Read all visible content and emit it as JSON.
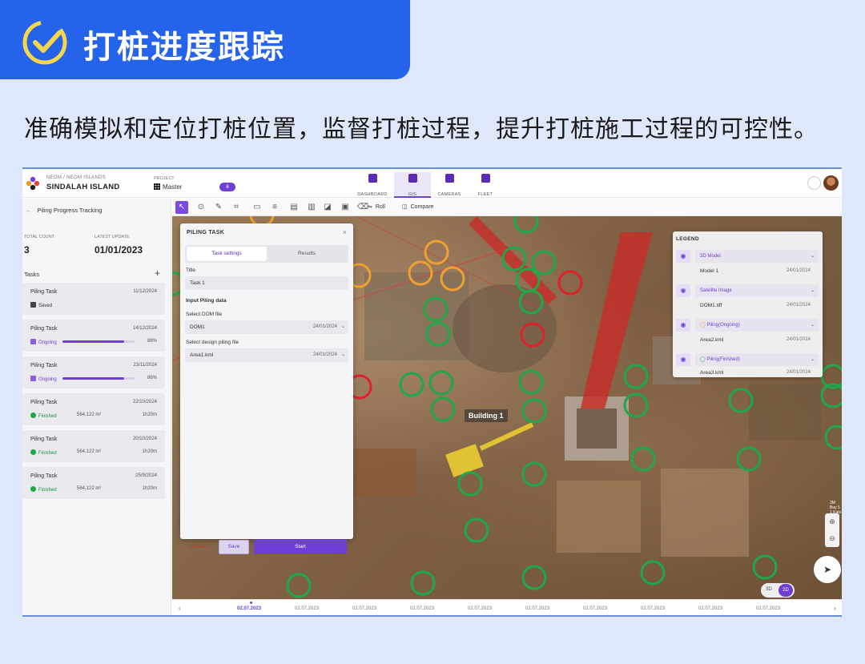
{
  "banner": {
    "title": "打桩进度跟踪",
    "subtitle": "准确模拟和定位打桩位置，监督打桩过程，提升打桩施工过程的可控性。"
  },
  "header": {
    "org": "NEOM / NEOM ISLANDS",
    "island": "SINDALAH ISLAND",
    "project_label": "PROJECT",
    "project_value": "Master",
    "project_badge": "6",
    "tabs": [
      {
        "label": "DASHBOARD",
        "icon": "dashboard-icon"
      },
      {
        "label": "GIS",
        "icon": "map-icon",
        "active": true
      },
      {
        "label": "CAMERAS",
        "icon": "camera-icon"
      },
      {
        "label": "FLEET",
        "icon": "truck-icon"
      }
    ]
  },
  "left": {
    "title": "Piling Progress Tracking",
    "total_count_label": "TOTAL COUNT",
    "total_count": "3",
    "latest_update_label": "LATEST UPDATE",
    "latest_update": "01/01/2023",
    "tasks_label": "Tasks",
    "cards": [
      {
        "name": "Piling Task",
        "date": "11/12/2024",
        "status": "Saved",
        "type": "saved"
      },
      {
        "name": "Piling Task",
        "date": "14/12/2024",
        "status": "Ongoing",
        "progress": "86%",
        "type": "ongoing"
      },
      {
        "name": "Piling Task",
        "date": "23/11/2024",
        "status": "Ongoing",
        "progress": "86%",
        "type": "ongoing"
      },
      {
        "name": "Piling Task",
        "date": "22/10/2024",
        "status": "Finished",
        "area": "564,122 m²",
        "duration": "1h20m",
        "type": "finished"
      },
      {
        "name": "Piling Task",
        "date": "20/10/2024",
        "status": "Finished",
        "area": "564,122 m²",
        "duration": "1h20m",
        "type": "finished"
      },
      {
        "name": "Piling Task",
        "date": "25/9/2024",
        "status": "Finished",
        "area": "564,122 m²",
        "duration": "1h20m",
        "type": "finished"
      }
    ]
  },
  "toolbar": {
    "roll": "Roll",
    "compare": "Compare"
  },
  "dialog": {
    "title": "PILING TASK",
    "tab_settings": "Task settings",
    "tab_results": "Results",
    "title_label": "Title",
    "title_value": "Task 1",
    "section": "Input Piling data",
    "dom_label": "Select DOM file",
    "dom_value": "DOM1",
    "dom_date": "24/01/2024",
    "design_label": "Select design piling file",
    "design_value": "Area1.kml",
    "design_date": "24/01/2024",
    "delete": "Delete",
    "save": "Save",
    "start": "Start"
  },
  "legend": {
    "title": "LEGEND",
    "groups": [
      {
        "name": "3D Model",
        "item": "Model 1",
        "date": "24/01/2024"
      },
      {
        "name": "Satellite Image",
        "item": "DOM1.tiff",
        "date": "24/01/2024"
      },
      {
        "name": "Piling(Ongoing)",
        "item": "Area2.kml",
        "date": "24/01/2024"
      },
      {
        "name": "Piling(Finished)",
        "item": "Area3.kml",
        "date": "24/01/2024"
      }
    ]
  },
  "map": {
    "building_label": "Building 1",
    "scale": "3M Buy 5 1 Kato B",
    "dim_3d": "3D",
    "dim_2d": "2D"
  },
  "timeline": {
    "dates": [
      "02.07.2023",
      "02.07.2023",
      "02.07.2023",
      "02.07.2023",
      "02.07.2023",
      "02.07.2023",
      "02.07.2023",
      "02.07.2023",
      "02.07.2023",
      "02.07.2023"
    ]
  },
  "colors": {
    "brand": "#2563eb",
    "accent": "#6d3fd3",
    "finished": "#1fa84a",
    "ongoing": "#f0a030",
    "missing": "#e0202a"
  }
}
